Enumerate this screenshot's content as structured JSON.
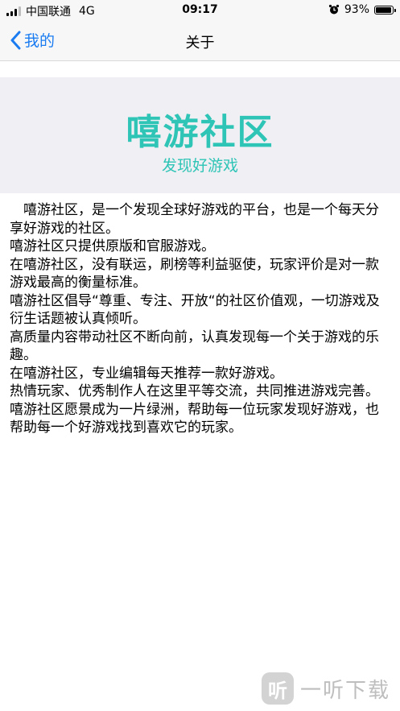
{
  "status_bar": {
    "carrier": "中国联通",
    "network": "4G",
    "time": "09:17",
    "battery": "93%",
    "battery_level": 0.93
  },
  "nav": {
    "back_label": "我的",
    "title": "关于"
  },
  "banner": {
    "title": "嘻游社区",
    "subtitle": "发现好游戏",
    "accent_color": "#2ec4b6"
  },
  "content": {
    "paragraphs": [
      "嘻游社区，是一个发现全球好游戏的平台，也是一个每天分享好游戏的社区。",
      "嘻游社区只提供原版和官服游戏。",
      "在嘻游社区，没有联运，刷榜等利益驱使，玩家评价是对一款游戏最高的衡量标准。",
      "嘻游社区倡导“尊重、专注、开放“的社区价值观，一切游戏及衍生话题被认真倾听。",
      "高质量内容带动社区不断向前，认真发现每一个关于游戏的乐趣。",
      "在嘻游社区，专业编辑每天推荐一款好游戏。",
      "热情玩家、优秀制作人在这里平等交流，共同推进游戏完善。",
      "嘻游社区愿景成为一片绿洲，帮助每一位玩家发现好游戏，也帮助每一个好游戏找到喜欢它的玩家。"
    ]
  },
  "watermark": {
    "badge": "听",
    "text": "一听下载"
  }
}
